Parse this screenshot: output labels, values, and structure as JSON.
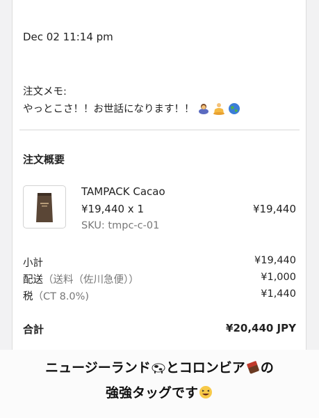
{
  "order": {
    "date": "Dec 02 11:14 pm",
    "memo_label": "注文メモ:",
    "memo_text": "やっとこさ！！お世話になります！！",
    "memo_emoji_icons": [
      "bowing-person-icon",
      "person-meditating-icon",
      "globe-icon"
    ],
    "summary_title": "注文概要",
    "product": {
      "name": "TAMPACK Cacao",
      "price_qty": "¥19,440 x 1",
      "sku": "SKU: tmpc-c-01",
      "line_total": "¥19,440"
    },
    "subtotal_label": "小計",
    "subtotal_value": "¥19,440",
    "shipping_label": "配送",
    "shipping_note": "（送料（佐川急便））",
    "shipping_value": "¥1,000",
    "tax_label": "税",
    "tax_note": "（CT 8.0%)",
    "tax_value": "¥1,440",
    "total_label": "合計",
    "total_value": "¥20,440 JPY"
  },
  "caption": {
    "line1_a": "ニュージーランド",
    "line1_b": "とコロンビア",
    "line1_c": "の",
    "line2": "強強タッグです",
    "icons": [
      "cow-icon",
      "chocolate-bar-icon",
      "grinning-squinting-face-icon"
    ]
  }
}
